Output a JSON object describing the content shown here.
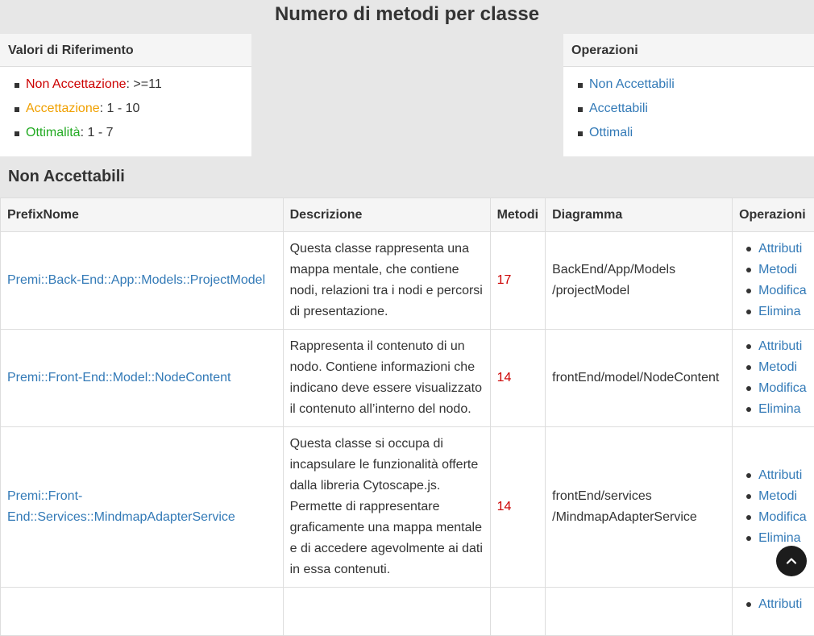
{
  "page": {
    "title": "Numero di metodi per classe"
  },
  "reference": {
    "title": "Valori di Riferimento",
    "items": [
      {
        "label": "Non Accettazione",
        "value": ": >=11",
        "color": "#cc0000"
      },
      {
        "label": "Accettazione",
        "value": ": 1 - 10",
        "color": "#f0a000"
      },
      {
        "label": "Ottimalità",
        "value": ": 1 - 7",
        "color": "#22aa22"
      }
    ]
  },
  "operations_panel": {
    "title": "Operazioni",
    "links": [
      "Non Accettabili",
      "Accettabili",
      "Ottimali"
    ]
  },
  "section": {
    "title": "Non Accettabili"
  },
  "table": {
    "headers": [
      "PrefixNome",
      "Descrizione",
      "Metodi",
      "Diagramma",
      "Operazioni"
    ],
    "ops": [
      "Attributi",
      "Metodi",
      "Modifica",
      "Elimina"
    ],
    "rows": [
      {
        "name": "Premi::Back-End::App::Models::ProjectModel",
        "description": "Questa classe rappresenta una mappa mentale, che contiene nodi, relazioni tra i nodi e percorsi di presentazione.",
        "methods": "17",
        "diagram": "BackEnd/App/Models /projectModel"
      },
      {
        "name": "Premi::Front-End::Model::NodeContent",
        "description": "Rappresenta il contenuto di un nodo. Contiene informazioni che indicano deve essere visualizzato il contenuto all’interno del nodo.",
        "methods": "14",
        "diagram": "frontEnd/model/NodeContent"
      },
      {
        "name": "Premi::Front-End::Services::MindmapAdapterService",
        "description": "Questa classe si occupa di incapsulare le funzionalità offerte dalla libreria Cytoscape.js. Permette di rappresentare graficamente una mappa mentale e di accedere agevolmente ai dati in essa contenuti.",
        "methods": "14",
        "diagram": "frontEnd/services /MindmapAdapterService"
      },
      {
        "name": "",
        "description": "",
        "methods": "",
        "diagram": ""
      }
    ]
  },
  "colors": {
    "link": "#337ab7",
    "danger": "#cc0000"
  },
  "icons": {
    "scroll_top": "chevron-up-icon"
  }
}
